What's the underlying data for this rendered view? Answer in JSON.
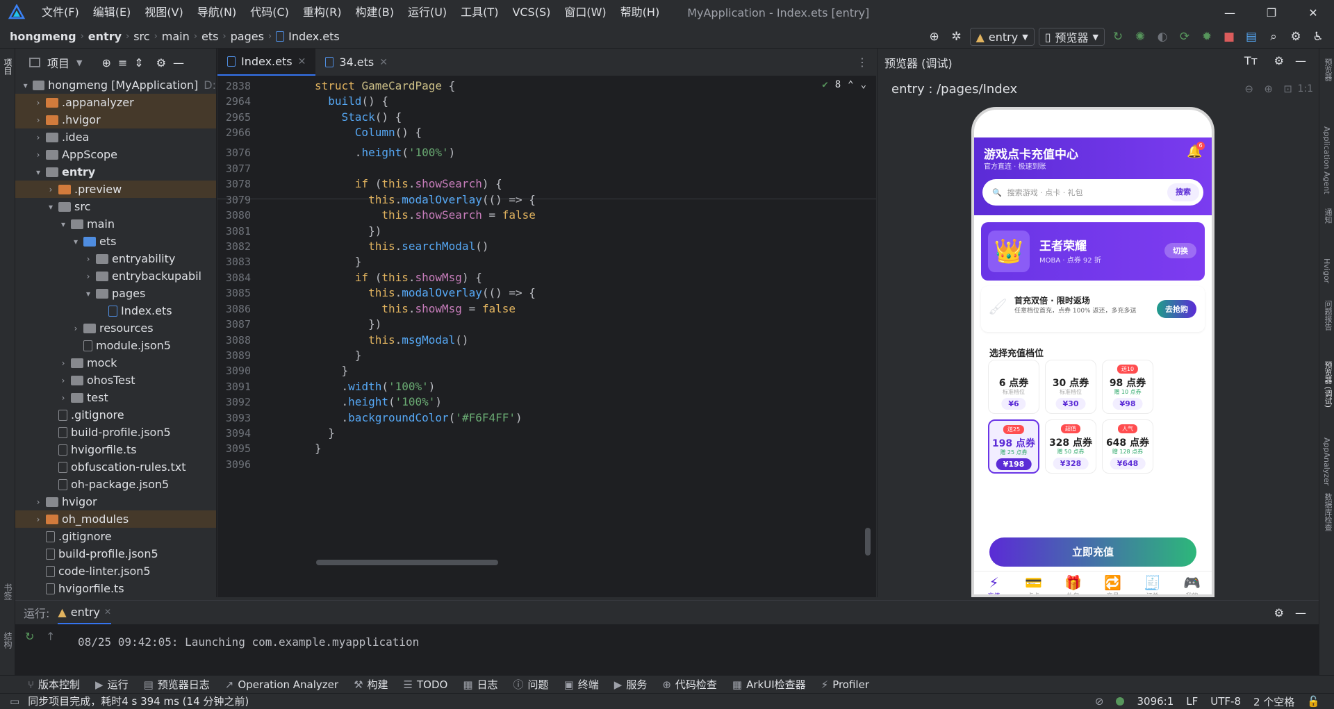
{
  "menu": [
    "文件(F)",
    "编辑(E)",
    "视图(V)",
    "导航(N)",
    "代码(C)",
    "重构(R)",
    "构建(B)",
    "运行(U)",
    "工具(T)",
    "VCS(S)",
    "窗口(W)",
    "帮助(H)"
  ],
  "window_title": "MyApplication - Index.ets [entry]",
  "breadcrumb": [
    "hongmeng",
    "entry",
    "src",
    "main",
    "ets",
    "pages",
    "Index.ets"
  ],
  "toolbar": {
    "run_config": "entry",
    "device": "预览器"
  },
  "project_panel": {
    "title": "项目"
  },
  "tree": [
    {
      "label": "hongmeng [MyApplication]",
      "suffix": "D:",
      "depth": 0,
      "arrow": "▾",
      "icon": "folder"
    },
    {
      "label": ".appanalyzer",
      "depth": 1,
      "arrow": "›",
      "icon": "folder-o",
      "hl": true
    },
    {
      "label": ".hvigor",
      "depth": 1,
      "arrow": "›",
      "icon": "folder-o",
      "hl": true
    },
    {
      "label": ".idea",
      "depth": 1,
      "arrow": "›",
      "icon": "folder"
    },
    {
      "label": "AppScope",
      "depth": 1,
      "arrow": "›",
      "icon": "folder"
    },
    {
      "label": "entry",
      "depth": 1,
      "arrow": "▾",
      "icon": "folder",
      "bold": true
    },
    {
      "label": ".preview",
      "depth": 2,
      "arrow": "›",
      "icon": "folder-o",
      "hl": true
    },
    {
      "label": "src",
      "depth": 2,
      "arrow": "▾",
      "icon": "folder"
    },
    {
      "label": "main",
      "depth": 3,
      "arrow": "▾",
      "icon": "folder"
    },
    {
      "label": "ets",
      "depth": 4,
      "arrow": "▾",
      "icon": "folder-b"
    },
    {
      "label": "entryability",
      "depth": 5,
      "arrow": "›",
      "icon": "folder"
    },
    {
      "label": "entrybackupabil",
      "depth": 5,
      "arrow": "›",
      "icon": "folder"
    },
    {
      "label": "pages",
      "depth": 5,
      "arrow": "▾",
      "icon": "folder"
    },
    {
      "label": "Index.ets",
      "depth": 6,
      "arrow": "",
      "icon": "ets"
    },
    {
      "label": "resources",
      "depth": 4,
      "arrow": "›",
      "icon": "folder"
    },
    {
      "label": "module.json5",
      "depth": 4,
      "arrow": "",
      "icon": "file"
    },
    {
      "label": "mock",
      "depth": 3,
      "arrow": "›",
      "icon": "folder"
    },
    {
      "label": "ohosTest",
      "depth": 3,
      "arrow": "›",
      "icon": "folder"
    },
    {
      "label": "test",
      "depth": 3,
      "arrow": "›",
      "icon": "folder"
    },
    {
      "label": ".gitignore",
      "depth": 2,
      "arrow": "",
      "icon": "file"
    },
    {
      "label": "build-profile.json5",
      "depth": 2,
      "arrow": "",
      "icon": "file"
    },
    {
      "label": "hvigorfile.ts",
      "depth": 2,
      "arrow": "",
      "icon": "file"
    },
    {
      "label": "obfuscation-rules.txt",
      "depth": 2,
      "arrow": "",
      "icon": "file"
    },
    {
      "label": "oh-package.json5",
      "depth": 2,
      "arrow": "",
      "icon": "file"
    },
    {
      "label": "hvigor",
      "depth": 1,
      "arrow": "›",
      "icon": "folder"
    },
    {
      "label": "oh_modules",
      "depth": 1,
      "arrow": "›",
      "icon": "folder-o",
      "hl": true
    },
    {
      "label": ".gitignore",
      "depth": 1,
      "arrow": "",
      "icon": "file"
    },
    {
      "label": "build-profile.json5",
      "depth": 1,
      "arrow": "",
      "icon": "file"
    },
    {
      "label": "code-linter.json5",
      "depth": 1,
      "arrow": "",
      "icon": "file"
    },
    {
      "label": "hvigorfile.ts",
      "depth": 1,
      "arrow": "",
      "icon": "file"
    }
  ],
  "editor_tabs": [
    {
      "label": "Index.ets",
      "active": true
    },
    {
      "label": "34.ets",
      "active": false
    }
  ],
  "inspections": "8",
  "code_lines": [
    {
      "n": "2838",
      "h": "<span class='kw'>struct</span> <span class='ty'>GameCardPage</span> {"
    },
    {
      "n": "2964",
      "h": "  <span class='fn'>build</span>() {"
    },
    {
      "n": "2965",
      "h": "    <span class='fn'>Stack</span>() {"
    },
    {
      "n": "2966",
      "h": "      <span class='fn'>Column</span>() {"
    },
    {
      "n": "3076",
      "h": "      .<span class='fn'>height</span>(<span class='st'>'100%'</span>)"
    },
    {
      "n": "3077",
      "h": ""
    },
    {
      "n": "3078",
      "h": "      <span class='kw'>if</span> (<span class='kw'>this</span>.<span class='pr'>showSearch</span>) {"
    },
    {
      "n": "3079",
      "h": "        <span class='kw'>this</span>.<span class='fn'>modalOverlay</span>(() => {"
    },
    {
      "n": "3080",
      "h": "          <span class='kw'>this</span>.<span class='pr'>showSearch</span> = <span class='kw'>false</span>"
    },
    {
      "n": "3081",
      "h": "        })"
    },
    {
      "n": "3082",
      "h": "        <span class='kw'>this</span>.<span class='fn'>searchModal</span>()"
    },
    {
      "n": "3083",
      "h": "      }"
    },
    {
      "n": "3084",
      "h": "      <span class='kw'>if</span> (<span class='kw'>this</span>.<span class='pr'>showMsg</span>) {"
    },
    {
      "n": "3085",
      "h": "        <span class='kw'>this</span>.<span class='fn'>modalOverlay</span>(() => {"
    },
    {
      "n": "3086",
      "h": "          <span class='kw'>this</span>.<span class='pr'>showMsg</span> = <span class='kw'>false</span>"
    },
    {
      "n": "3087",
      "h": "        })"
    },
    {
      "n": "3088",
      "h": "        <span class='kw'>this</span>.<span class='fn'>msgModal</span>()"
    },
    {
      "n": "3089",
      "h": "      }"
    },
    {
      "n": "3090",
      "h": "    }"
    },
    {
      "n": "3091",
      "h": "    .<span class='fn'>width</span>(<span class='st'>'100%'</span>)"
    },
    {
      "n": "3092",
      "h": "    .<span class='fn'>height</span>(<span class='st'>'100%'</span>)"
    },
    {
      "n": "3093",
      "h": "    .<span class='fn'>backgroundColor</span>(<span class='st'>'#F6F4FF'</span>)"
    },
    {
      "n": "3094",
      "h": "  }"
    },
    {
      "n": "3095",
      "h": "}"
    },
    {
      "n": "3096",
      "h": ""
    }
  ],
  "preview": {
    "panel_title": "预览器 (调试)",
    "path": "entry : /pages/Index",
    "app": {
      "title": "游戏点卡充值中心",
      "subtitle": "官方直连 · 极速到账",
      "badge": "6",
      "search_placeholder": "搜索游戏 · 点卡 · 礼包",
      "search_button": "搜索",
      "game_name": "王者荣耀",
      "game_sub": "MOBA · 点券 92 折",
      "switch_button": "切换",
      "promo_title": "首充双倍 · 限时返场",
      "promo_desc": "任意档位首充，点券 100% 返还，多充多送",
      "promo_button": "去抢购",
      "section_title": "选择充值档位",
      "packages": [
        {
          "tag": "",
          "name": "6 点券",
          "desc": "标准档位",
          "price": "¥6",
          "sel": false,
          "green": false
        },
        {
          "tag": "",
          "name": "30 点券",
          "desc": "标准档位",
          "price": "¥30",
          "sel": false,
          "green": false
        },
        {
          "tag": "送10",
          "name": "98 点券",
          "desc": "赠 10 点券",
          "price": "¥98",
          "sel": false,
          "green": true
        },
        {
          "tag": "送25",
          "name": "198 点券",
          "desc": "赠 25 点券",
          "price": "¥198",
          "sel": true,
          "green": true
        },
        {
          "tag": "超值",
          "name": "328 点券",
          "desc": "赠 50 点券",
          "price": "¥328",
          "sel": false,
          "green": true
        },
        {
          "tag": "人气",
          "name": "648 点券",
          "desc": "赠 128 点券",
          "price": "¥648",
          "sel": false,
          "green": true
        }
      ],
      "cta": "立即充值",
      "nav": [
        {
          "icon": "⚡",
          "label": "充值",
          "on": true
        },
        {
          "icon": "💳",
          "label": "点卡",
          "on": false
        },
        {
          "icon": "🎁",
          "label": "礼包",
          "on": false
        },
        {
          "icon": "🔁",
          "label": "交易",
          "on": false
        },
        {
          "icon": "🧾",
          "label": "订单",
          "on": false
        },
        {
          "icon": "🎮",
          "label": "我的",
          "on": false
        }
      ]
    }
  },
  "run": {
    "label": "运行:",
    "config": "entry",
    "output": "08/25 09:42:05: Launching com.example.myapplication"
  },
  "bottom_tools": [
    "版本控制",
    "运行",
    "预览器日志",
    "Operation Analyzer",
    "构建",
    "TODO",
    "日志",
    "问题",
    "终端",
    "服务",
    "代码检查",
    "ArkUI检查器",
    "Profiler"
  ],
  "status": {
    "message": "同步项目完成，耗时4 s 394 ms (14 分钟之前)",
    "position": "3096:1",
    "line_ending": "LF",
    "encoding": "UTF-8",
    "indent": "2 个空格"
  },
  "left_stripe": [
    "项目",
    "书签",
    "结构"
  ],
  "right_stripe": [
    "预览器",
    "Application Agent",
    "通知",
    "Hvigor",
    "问题报告",
    "预览器 (调试)",
    "AppAnalyzer",
    "数据库检查"
  ]
}
